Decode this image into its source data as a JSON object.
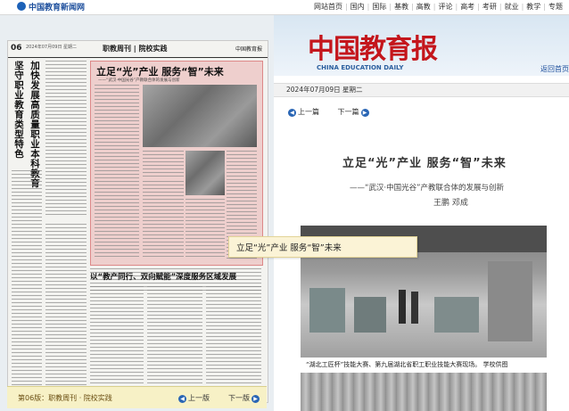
{
  "site": {
    "logo": "中国教育新闻网",
    "nav": [
      "网站首页",
      "国内",
      "国际",
      "基教",
      "高教",
      "评论",
      "高考",
      "考研",
      "就业",
      "教学",
      "专题"
    ]
  },
  "paper": {
    "page_no": "06",
    "date_line": "2024年07月09日 星期二",
    "column": "职教周刊 | 院校实践",
    "masthead_small": "中国教育报",
    "vertical_title_1": "加快发展高质量职业本科教育",
    "vertical_title_2": "坚守职业教育类型特色",
    "headline": "立足“光”产业 服务“智”未来",
    "headline_sub": "——“武汉·中国光谷”产教联合体的发展与创新",
    "subhead": "以“教产同行、双向赋能”深度服务区域发展",
    "footer_label": "第06版：职教周刊 · 院校实践",
    "prev": "上一版",
    "next": "下一版"
  },
  "tooltip": "立足“光”产业 服务“智”未来",
  "right": {
    "masthead": "中国教育报",
    "masthead_en": "CHINA EDUCATION DAILY",
    "back_link": "返回首页",
    "date": "2024年07月09日 星期二",
    "prev_article": "上一篇",
    "next_article": "下一篇",
    "title": "立足“光”产业 服务“智”未来",
    "subtitle": "——“武汉·中国光谷”产教联合体的发展与创新",
    "authors": "王鹏 邓成",
    "caption": "“湖北工匠杯”技能大赛、第九届湖北省职工职业技能大赛现场。 学校供图"
  },
  "colors": {
    "accent_red": "#c4161c",
    "link_blue": "#1c4e9c",
    "highlight": "#e48787"
  }
}
